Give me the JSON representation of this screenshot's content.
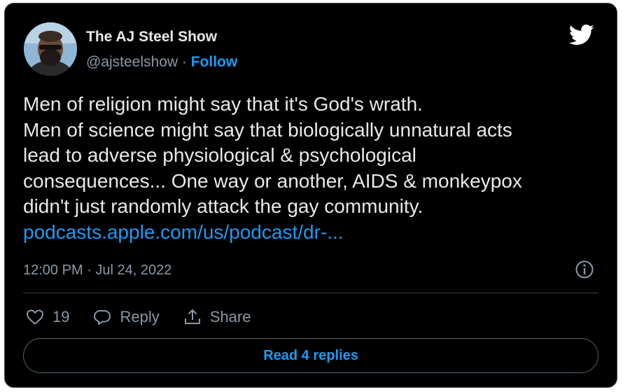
{
  "author": {
    "name": "The AJ Steel Show",
    "handle": "@ajsteelshow",
    "separator": "·",
    "follow_label": "Follow"
  },
  "tweet": {
    "lines": [
      "Men of religion might say that it's God's wrath.",
      "Men of science might say that biologically unnatural acts",
      "lead to adverse physiological & psychological",
      "consequences... One way or another, AIDS & monkeypox",
      "didn't just randomly attack the gay community."
    ],
    "link": "podcasts.apple.com/us/podcast/dr-...",
    "timestamp": "12:00 PM · Jul 24, 2022"
  },
  "actions": {
    "like_count": "19",
    "reply_label": "Reply",
    "share_label": "Share"
  },
  "read_replies_label": "Read 4 replies",
  "icons": {
    "brand": "twitter-bird-icon",
    "info": "info-icon",
    "like": "heart-icon",
    "reply": "reply-bubble-icon",
    "share": "share-icon"
  },
  "colors": {
    "background": "#000000",
    "text": "#e7e9ea",
    "secondary": "#8b98a5",
    "accent": "#1d9bf0"
  }
}
